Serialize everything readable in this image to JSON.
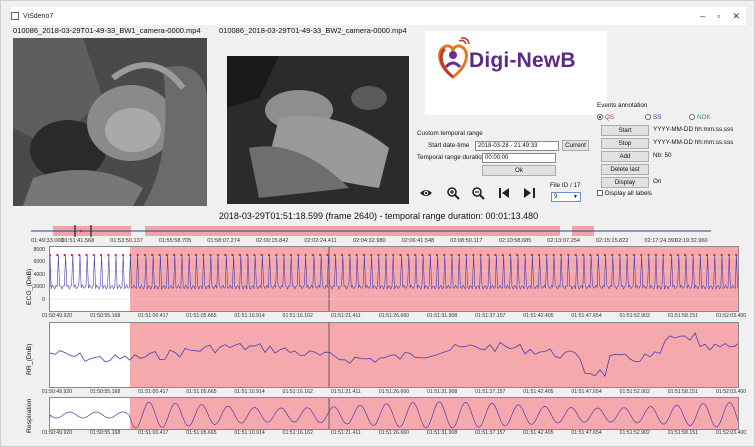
{
  "window": {
    "title": "ViSdeno7",
    "min": "–",
    "max": "▫",
    "close": "✕"
  },
  "videos": [
    {
      "label": "010086_2018-03-29T01-49-33_BW1_camera-0000.mp4"
    },
    {
      "label": "010086_2018-03-29T01-49-33_BW2_camera-0000.mp4"
    }
  ],
  "logo": {
    "text": "Digi-NewB"
  },
  "temporal": {
    "heading": "Custom temporal range",
    "start_label": "Start date-time",
    "start_value": "2018-03-28 - 21:49:33",
    "current_button": "Current",
    "duration_label": "Temporal range duration",
    "duration_value": "00:00:00",
    "ok_button": "Ok"
  },
  "file": {
    "label": "File ID / 17",
    "value": "9"
  },
  "events": {
    "heading": "Events annotation",
    "radios": [
      {
        "label": "QS",
        "color": "#c0392b",
        "selected": true
      },
      {
        "label": "SS",
        "color": "#2b3f9e",
        "selected": false
      },
      {
        "label": "NOK",
        "color": "#1e9e4a",
        "selected": false
      }
    ],
    "start_button": "Start",
    "start_fmt": "YYYY-MM-DD hh:mm:ss.sss",
    "stop_button": "Stop",
    "stop_fmt": "YYYY-MM-DD hh:mm:ss.sss",
    "add_button": "Add",
    "nb_text": "Nb: 50",
    "delete_button": "Delete last",
    "display_button": "Display",
    "display_state": "On",
    "display_all_label": "Display all labels"
  },
  "timeline": {
    "title": "2018-03-29T01:51:18.599 (frame 2640) - temporal range duration: 00:01:13.480",
    "ticks": [
      "01:49:33.000",
      "01:51:41.568",
      "01:53:50.137",
      "01:55:58.705",
      "01:58:07.274",
      "02:00:15.842",
      "02:02:24.411",
      "02:04:32.980",
      "02:06:41.548",
      "02:08:50.117",
      "02:10:58.685",
      "02:13:07.254",
      "02:15:15.822",
      "02:17:24.391",
      "02:19:32.960"
    ]
  },
  "plots": {
    "x_ticks": [
      "01:50:49.920",
      "01:50:55.168",
      "01:51:00.417",
      "01:51:05.665",
      "01:51:10.914",
      "01:51:16.162",
      "01:51:21.411",
      "01:51:26.660",
      "01:51:31.908",
      "01:51:37.157",
      "01:51:42.405",
      "01:51:47.654",
      "01:51:52.902",
      "01:51:58.151",
      "01:52:03.400"
    ],
    "ecg": {
      "ylabel": "ECG_(DnB)",
      "yticks": [
        "8000",
        "6000",
        "4000",
        "2000",
        "0"
      ]
    },
    "rr": {
      "ylabel": "RR_(DnB)"
    },
    "resp": {
      "ylabel": "Respiration"
    }
  },
  "colors": {
    "annotation": "#f6a9ad",
    "signal": "#4a3fb0",
    "peak": "#d02828",
    "timeline_band": "#f3a3a8"
  }
}
